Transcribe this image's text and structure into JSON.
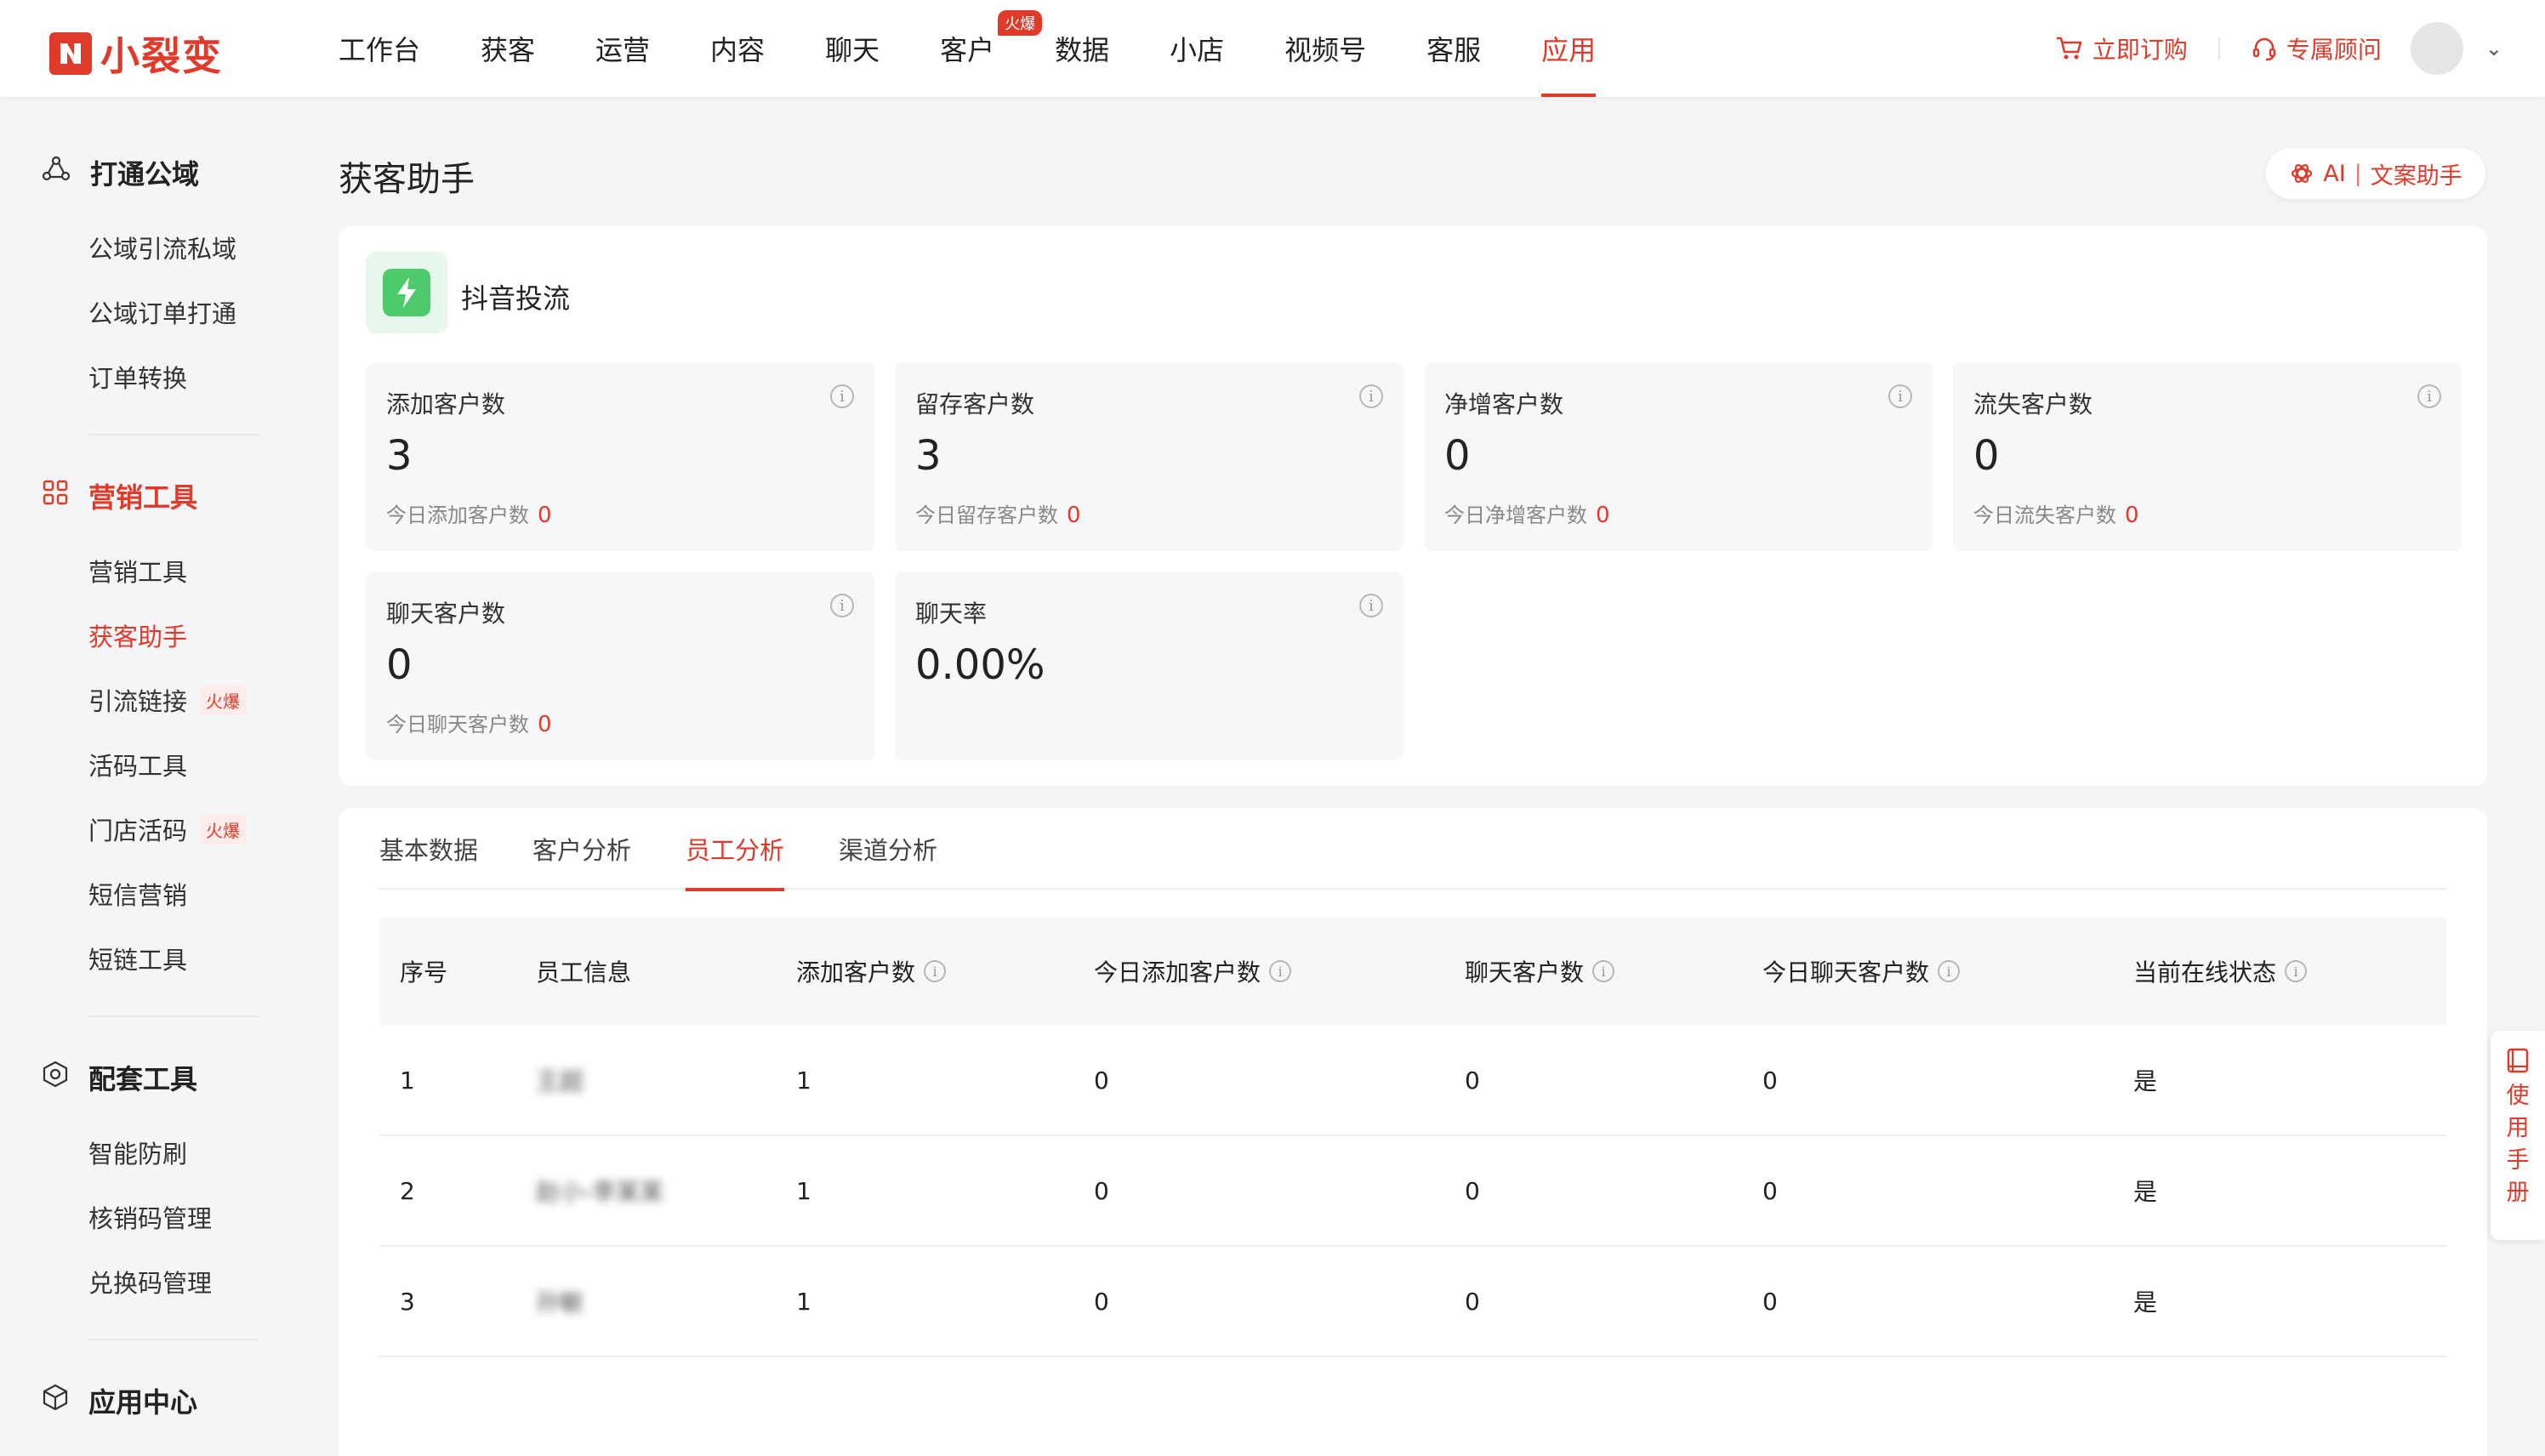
{
  "header": {
    "logo_text": "小裂变",
    "nav": [
      {
        "label": "工作台"
      },
      {
        "label": "获客"
      },
      {
        "label": "运营"
      },
      {
        "label": "内容"
      },
      {
        "label": "聊天"
      },
      {
        "label": "客户",
        "badge": "火爆"
      },
      {
        "label": "数据"
      },
      {
        "label": "小店"
      },
      {
        "label": "视频号"
      },
      {
        "label": "客服"
      },
      {
        "label": "应用",
        "active": true
      }
    ],
    "order_label": "立即订购",
    "advisor_label": "专属顾问"
  },
  "sidebar": {
    "sections": [
      {
        "title": "打通公域",
        "icon": "cloud-share-icon",
        "items": [
          "公域引流私域",
          "公域订单打通",
          "订单转换"
        ]
      },
      {
        "title": "营销工具",
        "icon": "grid-icon",
        "active": true,
        "items": [
          "营销工具",
          "获客助手",
          "引流链接",
          "活码工具",
          "门店活码",
          "短信营销",
          "短链工具"
        ]
      },
      {
        "title": "配套工具",
        "icon": "target-icon",
        "items": [
          "智能防刷",
          "核销码管理",
          "兑换码管理"
        ]
      },
      {
        "title": "应用中心",
        "icon": "cube-icon",
        "items": []
      }
    ],
    "tags": {
      "引流链接": "火爆",
      "门店活码": "火爆"
    },
    "active_item": "获客助手"
  },
  "page": {
    "title": "获客助手",
    "ai_button": {
      "ai": "AI",
      "sep": "|",
      "label": "文案助手"
    }
  },
  "source": {
    "title": "抖音投流",
    "icon": "douyin-flow-icon"
  },
  "stats": [
    {
      "label": "添加客户数",
      "value": "3",
      "sub": "今日添加客户数",
      "sub_value": "0"
    },
    {
      "label": "留存客户数",
      "value": "3",
      "sub": "今日留存客户数",
      "sub_value": "0"
    },
    {
      "label": "净增客户数",
      "value": "0",
      "sub": "今日净增客户数",
      "sub_value": "0"
    },
    {
      "label": "流失客户数",
      "value": "0",
      "sub": "今日流失客户数",
      "sub_value": "0"
    },
    {
      "label": "聊天客户数",
      "value": "0",
      "sub": "今日聊天客户数",
      "sub_value": "0"
    },
    {
      "label": "聊天率",
      "value": "0.00%"
    }
  ],
  "tabs": [
    "基本数据",
    "客户分析",
    "员工分析",
    "渠道分析"
  ],
  "active_tab": "员工分析",
  "table": {
    "headers": [
      "序号",
      "员工信息",
      "添加客户数",
      "今日添加客户数",
      "聊天客户数",
      "今日聊天客户数",
      "当前在线状态"
    ],
    "rows": [
      [
        "1",
        "王超",
        "1",
        "0",
        "0",
        "0",
        "是"
      ],
      [
        "2",
        "赵小-李某某",
        "1",
        "0",
        "0",
        "0",
        "是"
      ],
      [
        "3",
        "孙敏",
        "1",
        "0",
        "0",
        "0",
        "是"
      ]
    ]
  },
  "manual": {
    "label": "使用手册",
    "chars": [
      "使",
      "用",
      "手",
      "册"
    ]
  },
  "colors": {
    "accent": "#e03a2a",
    "background": "#f4f5f7",
    "card": "#ffffff",
    "stat_bg": "#f6f7f9"
  }
}
